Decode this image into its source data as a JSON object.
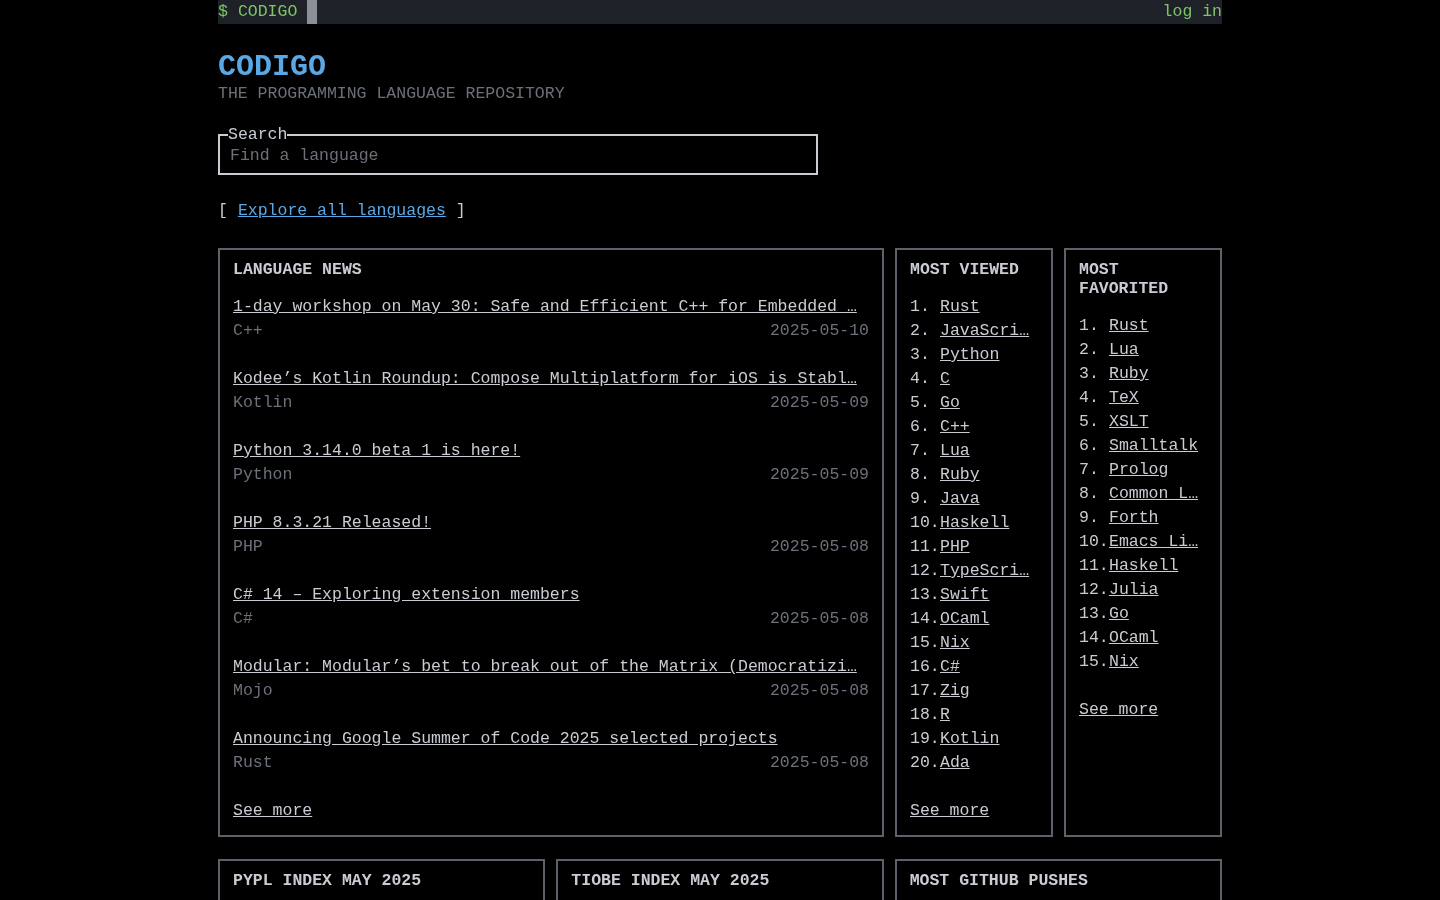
{
  "top_bar": {
    "prompt": "$",
    "brand": "CODIGO",
    "login": "log in"
  },
  "header": {
    "title": "CODIGO",
    "subtitle": "THE PROGRAMMING LANGUAGE REPOSITORY"
  },
  "search": {
    "label": "Search",
    "placeholder": "Find a language"
  },
  "explore": {
    "open": "[",
    "link": "Explore all languages",
    "close": "]"
  },
  "news": {
    "title": "LANGUAGE NEWS",
    "items": [
      {
        "title": "1-day workshop on May 30: Safe and Efficient C++ for Embedded …",
        "language": "C++",
        "date": "2025-05-10"
      },
      {
        "title": "Kodee’s Kotlin Roundup: Compose Multiplatform for iOS is Stabl…",
        "language": "Kotlin",
        "date": "2025-05-09"
      },
      {
        "title": "Python 3.14.0 beta 1 is here!",
        "language": "Python",
        "date": "2025-05-09"
      },
      {
        "title": "PHP 8.3.21 Released!",
        "language": "PHP",
        "date": "2025-05-08"
      },
      {
        "title": "C# 14 – Exploring extension members",
        "language": "C#",
        "date": "2025-05-08"
      },
      {
        "title": "Modular: Modular’s bet to break out of the Matrix (Democratizi…",
        "language": "Mojo",
        "date": "2025-05-08"
      },
      {
        "title": "Announcing Google Summer of Code 2025 selected projects",
        "language": "Rust",
        "date": "2025-05-08"
      }
    ],
    "see_more": "See more"
  },
  "most_viewed": {
    "title": "MOST VIEWED",
    "items": [
      {
        "rank": "1.",
        "name": "Rust"
      },
      {
        "rank": "2.",
        "name": "JavaScri…"
      },
      {
        "rank": "3.",
        "name": "Python"
      },
      {
        "rank": "4.",
        "name": "C"
      },
      {
        "rank": "5.",
        "name": "Go"
      },
      {
        "rank": "6.",
        "name": "C++"
      },
      {
        "rank": "7.",
        "name": "Lua"
      },
      {
        "rank": "8.",
        "name": "Ruby"
      },
      {
        "rank": "9.",
        "name": "Java"
      },
      {
        "rank": "10.",
        "name": "Haskell"
      },
      {
        "rank": "11.",
        "name": "PHP"
      },
      {
        "rank": "12.",
        "name": "TypeScri…"
      },
      {
        "rank": "13.",
        "name": "Swift"
      },
      {
        "rank": "14.",
        "name": "OCaml"
      },
      {
        "rank": "15.",
        "name": "Nix"
      },
      {
        "rank": "16.",
        "name": "C#"
      },
      {
        "rank": "17.",
        "name": "Zig"
      },
      {
        "rank": "18.",
        "name": "R"
      },
      {
        "rank": "19.",
        "name": "Kotlin"
      },
      {
        "rank": "20.",
        "name": "Ada"
      }
    ],
    "see_more": "See more"
  },
  "most_favorited": {
    "title": "MOST FAVORITED",
    "items": [
      {
        "rank": "1.",
        "name": "Rust"
      },
      {
        "rank": "2.",
        "name": "Lua"
      },
      {
        "rank": "3.",
        "name": "Ruby"
      },
      {
        "rank": "4.",
        "name": "TeX"
      },
      {
        "rank": "5.",
        "name": "XSLT"
      },
      {
        "rank": "6.",
        "name": "Smalltalk"
      },
      {
        "rank": "7.",
        "name": "Prolog"
      },
      {
        "rank": "8.",
        "name": "Common L…"
      },
      {
        "rank": "9.",
        "name": "Forth"
      },
      {
        "rank": "10.",
        "name": "Emacs Li…"
      },
      {
        "rank": "11.",
        "name": "Haskell"
      },
      {
        "rank": "12.",
        "name": "Julia"
      },
      {
        "rank": "13.",
        "name": "Go"
      },
      {
        "rank": "14.",
        "name": "OCaml"
      },
      {
        "rank": "15.",
        "name": "Nix"
      }
    ],
    "see_more": "See more"
  },
  "bottom_panels": [
    {
      "title": "PYPL INDEX MAY 2025"
    },
    {
      "title": "TIOBE INDEX MAY 2025"
    },
    {
      "title": "MOST GITHUB PUSHES"
    }
  ]
}
